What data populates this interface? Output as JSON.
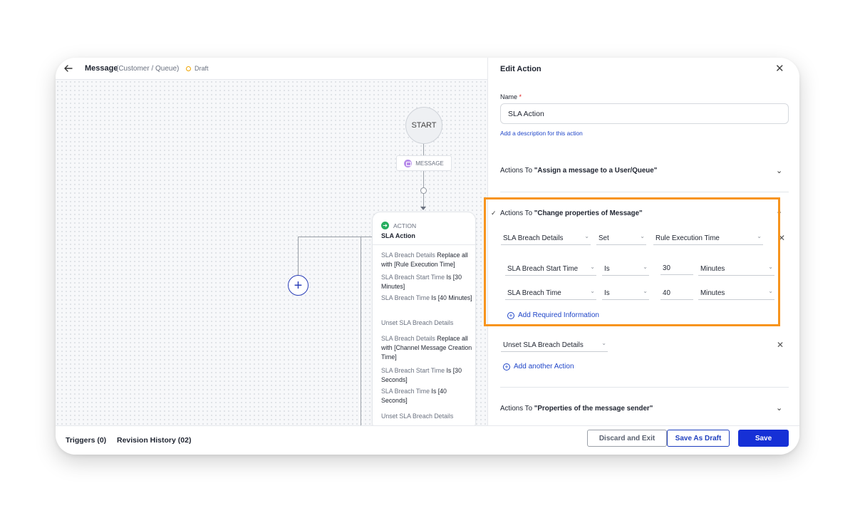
{
  "header": {
    "title": "Message",
    "subtitle": "(Customer / Queue)",
    "status": "Draft"
  },
  "flow": {
    "start_label": "START",
    "message_node_label": "MESSAGE",
    "action_card": {
      "type_label": "ACTION",
      "title": "SLA Action",
      "rules": [
        {
          "key": "SLA Breach Details",
          "text": " Replace all with [Rule Execution Time]"
        },
        {
          "key": "SLA Breach Start Time",
          "text": " Is [30 Minutes]"
        },
        {
          "key": "SLA Breach Time",
          "text": " Is [40 Minutes]"
        },
        {
          "key": "Unset SLA Breach Details",
          "text": ""
        },
        {
          "key": "SLA Breach Details",
          "text": " Replace all with [Channel Message Creation Time]"
        },
        {
          "key": "SLA Breach Start Time",
          "text": " Is [30 Seconds]"
        },
        {
          "key": "SLA Breach Time",
          "text": " Is [40 Seconds]"
        },
        {
          "key": "Unset SLA Breach Details",
          "text": ""
        }
      ]
    },
    "add_branch_symbol": "+"
  },
  "footer": {
    "triggers_label": "Triggers (0)",
    "revision_label": "Revision History (02)",
    "discard_label": "Discard and Exit",
    "save_draft_label": "Save As Draft",
    "save_label": "Save"
  },
  "edit_panel": {
    "title": "Edit Action",
    "name_label": "Name",
    "required_mark": "*",
    "name_value": "SLA Action",
    "description_link": "Add a description for this action",
    "section_assign": {
      "prefix": "Actions To ",
      "target": "\"Assign a message to a User/Queue\""
    },
    "section_change": {
      "prefix": "Actions To ",
      "target": "\"Change properties of Message\"",
      "row1": {
        "field": "SLA Breach Details",
        "op": "Set",
        "value": "Rule Execution Time"
      },
      "row2": {
        "field": "SLA Breach Start Time",
        "op": "Is",
        "value": "30",
        "unit": "Minutes"
      },
      "row3": {
        "field": "SLA Breach Time",
        "op": "Is",
        "value": "40",
        "unit": "Minutes"
      },
      "add_required": "Add Required Information",
      "unset_field": "Unset SLA Breach Details",
      "add_another": "Add another Action"
    },
    "section_sender": {
      "prefix": "Actions To ",
      "target": "\"Properties of the message sender\""
    }
  },
  "colors": {
    "accent": "#1630d6",
    "highlight": "#f7941d",
    "action_icon": "#27ae60",
    "draft_status": "#f0a500"
  }
}
